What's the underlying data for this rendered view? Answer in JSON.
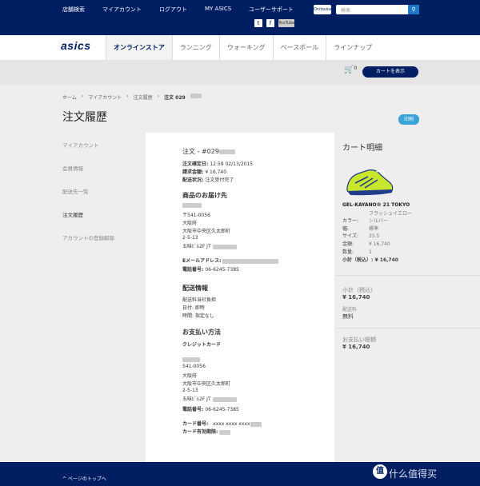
{
  "top": {
    "links": [
      "店舗検索",
      "マイアカウント",
      "ログアウト",
      "MY ASICS",
      "ユーザーサポート"
    ],
    "search_placeholder": "検索",
    "tiger_logo": "Onitsuka Tiger",
    "social": [
      "t",
      "f",
      "YouTube"
    ]
  },
  "nav": {
    "logo": "asics",
    "items": [
      "オンラインストア",
      "ランニング",
      "ウォーキング",
      "ベースボール",
      "ラインナップ"
    ]
  },
  "cart": {
    "count": "0",
    "button": "カートを表示"
  },
  "breadcrumb": [
    "ホーム",
    "マイアカウント",
    "注文履歴",
    "注文 029"
  ],
  "page_title": "注文履歴",
  "print_button": "印刷",
  "sidebar": [
    "マイアカウント",
    "会員情報",
    "配送先一覧",
    "注文履歴",
    "アカウントの登録解除"
  ],
  "order": {
    "number": "注文 - #029",
    "date_label": "注文確定日:",
    "date_value": "12:59 02/13/2015",
    "amount_label": "請求金額:",
    "amount_value": "¥ 16,740",
    "status_label": "配送状況:",
    "status_value": "注文受付完了",
    "shipto_title": "商品のお届け先",
    "shipto_lines": [
      "〒541-0056",
      "大阪府",
      "大阪市中央区久太郎町",
      "2-5-13",
      "五味ﾋﾞﾙ2F JT"
    ],
    "email_label": "Eメールアドレス:",
    "phone1_label": "電話番号:",
    "phone1_value": "06-6245-7385",
    "delivery_title": "配送情報",
    "delivery_lines": [
      "配送料当社負担",
      "日付: 即時",
      "時間: 指定なし"
    ],
    "payment_title": "お支払い方法",
    "payment_method": "クレジットカード",
    "bill_lines": [
      "541-0056",
      "大阪府",
      "大阪市中央区久太郎町",
      "2-5-13",
      "五味ﾋﾞﾙ2F JT"
    ],
    "phone2_label": "電話番号:",
    "phone2_value": "06-6245-7385",
    "card_no_label": "カード番号:",
    "card_no_value": "xxxx xxxx xxxx",
    "card_exp_label": "カード有効期限:"
  },
  "cart_detail": {
    "title": "カート明細",
    "product": "GEL-KAYANO® 21 TOKYO",
    "color_name": "フラッシュイエロー",
    "rows": [
      {
        "label": "カラー:",
        "value": "シルバー"
      },
      {
        "label": "幅:",
        "value": "標準"
      },
      {
        "label": "サイズ:",
        "value": "25.5"
      },
      {
        "label": "金額:",
        "value": "¥ 16,740"
      },
      {
        "label": "数量:",
        "value": "1"
      }
    ],
    "subtotal_label": "小計（税込）:",
    "subtotal_value": "¥ 16,740",
    "sum_label": "小計（税込）",
    "sum_value": "¥ 16,740",
    "shipping_label": "配送料",
    "shipping_value": "無料",
    "total_label": "お支払い総額",
    "total_value": "¥ 16,740"
  },
  "footer": {
    "back_to_top": "^ ページのトップへ"
  },
  "watermark": {
    "mark": "值",
    "text": "什么值得买"
  },
  "colors": {
    "brand_navy": "#001e62",
    "accent_blue": "#3aa3d8"
  }
}
